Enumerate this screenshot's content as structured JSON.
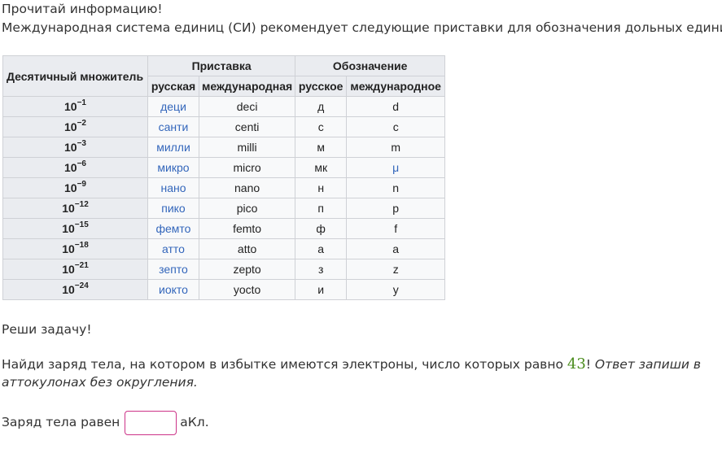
{
  "intro": {
    "line1": "Прочитай информацию!",
    "line2": "Международная система единиц (СИ) рекомендует следующие приставки для обозначения дольных единиц:"
  },
  "table": {
    "header_multiplier": "Десятичный множитель",
    "header_prefix": "Приставка",
    "header_symbol": "Обозначение",
    "sub_prefix_ru": "русская",
    "sub_prefix_int": "международная",
    "sub_symbol_ru": "русское",
    "sub_symbol_int": "международное",
    "rows": [
      {
        "base": "10",
        "exp": "−1",
        "ru": "деци",
        "int": "deci",
        "sym_ru": "д",
        "sym_int": "d"
      },
      {
        "base": "10",
        "exp": "−2",
        "ru": "санти",
        "int": "centi",
        "sym_ru": "с",
        "sym_int": "c"
      },
      {
        "base": "10",
        "exp": "−3",
        "ru": "милли",
        "int": "milli",
        "sym_ru": "м",
        "sym_int": "m"
      },
      {
        "base": "10",
        "exp": "−6",
        "ru": "микро",
        "int": "micro",
        "sym_ru": "мк",
        "sym_int": "μ"
      },
      {
        "base": "10",
        "exp": "−9",
        "ru": "нано",
        "int": "nano",
        "sym_ru": "н",
        "sym_int": "n"
      },
      {
        "base": "10",
        "exp": "−12",
        "ru": "пико",
        "int": "pico",
        "sym_ru": "п",
        "sym_int": "p"
      },
      {
        "base": "10",
        "exp": "−15",
        "ru": "фемто",
        "int": "femto",
        "sym_ru": "ф",
        "sym_int": "f"
      },
      {
        "base": "10",
        "exp": "−18",
        "ru": "атто",
        "int": "atto",
        "sym_ru": "а",
        "sym_int": "a"
      },
      {
        "base": "10",
        "exp": "−21",
        "ru": "зепто",
        "int": "zepto",
        "sym_ru": "з",
        "sym_int": "z"
      },
      {
        "base": "10",
        "exp": "−24",
        "ru": "иокто",
        "int": "yocto",
        "sym_ru": "и",
        "sym_int": "y"
      }
    ]
  },
  "task": {
    "solve": "Реши задачу!",
    "question_pre": "Найди заряд тела, на котором в избытке имеются электроны, число которых равно ",
    "number": "43",
    "question_post": "! ",
    "instruction_1": "Ответ запиши в",
    "instruction_2": "аттокулонах без округления.",
    "answer_label": "Заряд тела равен",
    "answer_value": "",
    "answer_unit": "аКл."
  },
  "colors": {
    "link": "#3366bb",
    "number_accent": "#4a8c1c",
    "input_border": "#cc3388"
  }
}
